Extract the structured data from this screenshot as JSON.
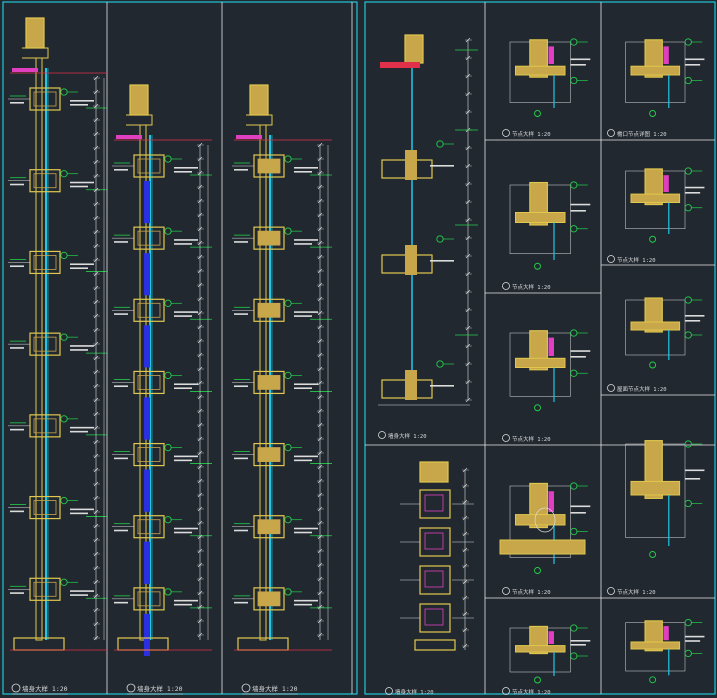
{
  "drawing": {
    "background": "#212830",
    "colors": {
      "frame": "#1fc8d8",
      "border": "#e8e8e8",
      "wall": "#c8a64a",
      "insulation": "#e0c84e",
      "glass": "#20c8e8",
      "slab": "#b09040",
      "dim": "#dcdcdc",
      "leader": "#22d04a",
      "redline": "#e0304a",
      "magenta": "#e040c0",
      "blue": "#2a30e0"
    },
    "left_sheet": {
      "sections": [
        {
          "id": "section-1",
          "caption": "墙身大样 1:20"
        },
        {
          "id": "section-2",
          "caption": "墙身大样 1:20"
        },
        {
          "id": "section-3",
          "caption": "墙身大样 1:20"
        }
      ]
    },
    "right_sheet": {
      "details": [
        {
          "id": "detail-wall-a",
          "caption": "墙身大样 1:20"
        },
        {
          "id": "detail-a",
          "caption": "节点大样 1:20"
        },
        {
          "id": "detail-b",
          "caption": "檐口节点详图 1:20"
        },
        {
          "id": "detail-c",
          "caption": "节点大样 1:20"
        },
        {
          "id": "detail-d",
          "caption": "节点大样 1:20"
        },
        {
          "id": "detail-e",
          "caption": "节点大样 1:20"
        },
        {
          "id": "detail-f",
          "caption": "屋面节点大样 1:20"
        },
        {
          "id": "detail-g",
          "caption": "节点大样 1:20"
        },
        {
          "id": "detail-wall-b",
          "caption": "墙身大样 1:20"
        },
        {
          "id": "detail-h",
          "caption": "节点大样 1:20"
        },
        {
          "id": "detail-i",
          "caption": "节点大样 1:20"
        },
        {
          "id": "detail-j",
          "caption": ""
        },
        {
          "id": "detail-k",
          "caption": ""
        }
      ]
    }
  }
}
